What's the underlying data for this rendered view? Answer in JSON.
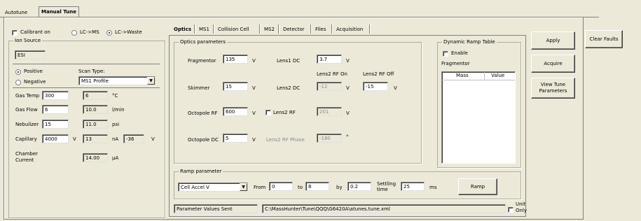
{
  "tabs": {
    "autotune": "Autotune",
    "manual_tune": "Manual Tune"
  },
  "top_options": {
    "calibrant_on": "Calibrant on",
    "lc_ms": "LC->MS",
    "lc_waste": "LC->Waste"
  },
  "ion_source": {
    "title": "Ion Source",
    "source_value": "ESI",
    "positive": "Positive",
    "negative": "Negative",
    "scan_type_label": "Scan Type:",
    "scan_type_value": "MS1 Profile",
    "gas_temp": {
      "label": "Gas Temp",
      "set": "300",
      "actual": "6",
      "unit": "°C"
    },
    "gas_flow": {
      "label": "Gas Flow",
      "set": "6",
      "actual": "10.0",
      "unit": "l/min"
    },
    "nebulizer": {
      "label": "Nebulizer",
      "set": "15",
      "actual": "11.0",
      "unit": "psi"
    },
    "capillary": {
      "label": "Capillary",
      "set": "4000",
      "set_unit": "V",
      "actual": "13",
      "actual_unit": "nA",
      "extra": "-36",
      "extra_unit": "V"
    },
    "chamber_current": {
      "label_line1": "Chamber",
      "label_line2": "Current",
      "value": "14.00",
      "unit": "µA"
    }
  },
  "sub_tabs": [
    "Optics",
    "MS1",
    "Collision Cell",
    "MS2",
    "Detector",
    "Files",
    "Acquisition"
  ],
  "optics": {
    "title": "Optics parameters",
    "fragmentor": {
      "label": "Fragmentor",
      "value": "135",
      "unit": "V"
    },
    "skimmer": {
      "label": "Skimmer",
      "value": "15",
      "unit": "V"
    },
    "octopole_rf": {
      "label": "Octopole RF",
      "value": "600",
      "unit": "V"
    },
    "octopole_dc": {
      "label": "Octopole DC",
      "value": "5",
      "unit": "V"
    },
    "lens1_dc": {
      "label": "Lens1 DC",
      "value": "3.7",
      "unit": "V"
    },
    "lens2_rf_on_label": "Lens2 RF On",
    "lens2_rf_off_label": "Lens2 RF Off",
    "lens2_dc": {
      "label": "Lens2 DC",
      "on_value": "-12",
      "unit": "V",
      "off_value": "-15",
      "off_unit": "V"
    },
    "lens2_rf": {
      "label": "Lens2 RF",
      "value": "201",
      "unit": "V"
    },
    "lens2_rf_phase": {
      "label": "Lens2 RF Phase",
      "value": "-180",
      "unit": "°"
    }
  },
  "ramp_table": {
    "title": "Dynamic Ramp Table",
    "enable": "Enable",
    "param": "Fragmentor",
    "col_mass": "Mass",
    "col_value": "Value"
  },
  "ramp": {
    "title": "Ramp parameter",
    "param_value": "Cell Accel V",
    "from_label": "From",
    "from_value": "0",
    "to_label": "to",
    "to_value": "8",
    "by_label": "by",
    "by_value": "0.2",
    "settling_label_1": "Settling",
    "settling_label_2": "time",
    "settling_value": "25",
    "settling_unit": "ms",
    "ramp_button": "Ramp"
  },
  "status": {
    "message": "Parameter Values Sent",
    "path": "C:\\MassHunter\\Tune\\QQQ\\G6420A\\atunes.tune.xml",
    "unit_only_1": "Unit",
    "unit_only_2": "Only"
  },
  "buttons": {
    "apply": "Apply",
    "acquire": "Acquire",
    "view_tune_1": "View Tune",
    "view_tune_2": "Parameters",
    "clear_faults": "Clear Faults"
  }
}
